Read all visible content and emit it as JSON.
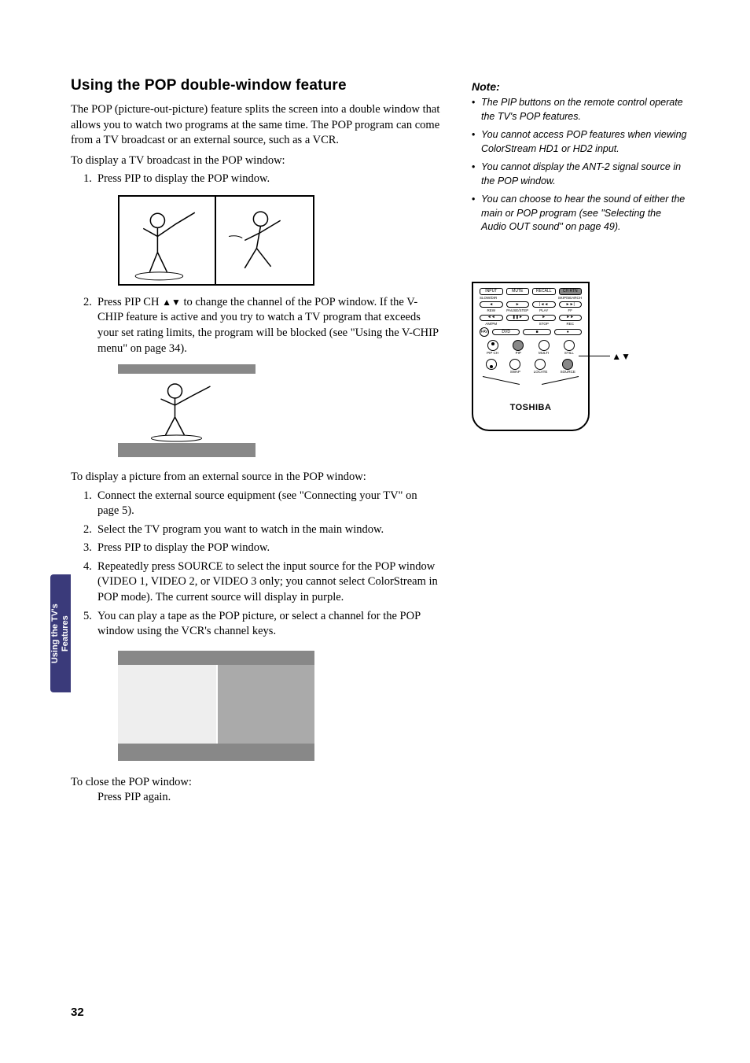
{
  "main": {
    "heading": "Using the POP double-window feature",
    "intro": "The POP (picture-out-picture) feature splits the screen into a double window that allows you to watch two programs at the same time. The POP program can come from a TV broadcast or an external source, such as a VCR.",
    "tv_broadcast_lead": "To display a TV broadcast in the POP window:",
    "steps_a": {
      "s1_num": "1.",
      "s1": "Press PIP to display the POP window.",
      "s2_num": "2.",
      "s2_prefix": "Press PIP CH ",
      "s2_arrows": "▲▼",
      "s2_rest": " to change the channel of the POP window. If the V-CHIP feature is active and you try to watch a TV program that exceeds your set rating limits, the program will be blocked (see \"Using the V-CHIP menu\" on page 34)."
    },
    "external_lead": "To display a picture from an external source in the POP window:",
    "steps_b": {
      "s1_num": "1.",
      "s1": "Connect the external source equipment (see \"Connecting your TV\" on page 5).",
      "s2_num": "2.",
      "s2": "Select the TV program you want to watch in the main window.",
      "s3_num": "3.",
      "s3": "Press PIP to display the POP window.",
      "s4_num": "4.",
      "s4": "Repeatedly press SOURCE to select the input source for the POP window (VIDEO 1, VIDEO 2, or VIDEO 3 only; you cannot select ColorStream in POP mode). The current source will display in purple.",
      "s5_num": "5.",
      "s5": "You can play a tape as the POP picture, or select a channel for the POP window using the VCR's channel keys."
    },
    "close_lead": "To close the POP window:",
    "close_action": "Press PIP again."
  },
  "notes": {
    "heading": "Note:",
    "n1": "The PIP buttons on the remote control operate the TV's POP features.",
    "n2": "You cannot access POP features when viewing ColorStream HD1 or HD2 input.",
    "n3": "You cannot display the ANT-2 signal source in the POP window.",
    "n4": "You can choose to hear the sound of either the main or POP program (see \"Selecting the Audio OUT sound\" on page 49)."
  },
  "remote": {
    "btns_top": {
      "input": "INPUT",
      "mute": "MUTE",
      "recall": "RECALL",
      "chrtn": "CH RTN"
    },
    "row2_left": "SLOW/DIR",
    "row2_right": "SKIP/SEARCH",
    "row3": {
      "rew": "REW",
      "pause": "PAUSE/STEP",
      "play": "PLAY",
      "ff": "FF"
    },
    "row4": {
      "ampm": "AM/PM",
      "stop": "STOP",
      "rec": "REC"
    },
    "fav": "FAV",
    "dvd": "DVD",
    "circles": {
      "pipch": "PIP CH",
      "pip": "PIP",
      "multi": "MULTI",
      "still": "STILL",
      "swap": "SWAP",
      "locate": "LOCATE",
      "source": "SOURCE"
    },
    "brand": "TOSHIBA",
    "callout_arrows": "▲▼"
  },
  "sidetab": "Using the TV's\nFeatures",
  "sidetab_line1": "Using the TV's",
  "sidetab_line2": "Features",
  "page_number": "32"
}
